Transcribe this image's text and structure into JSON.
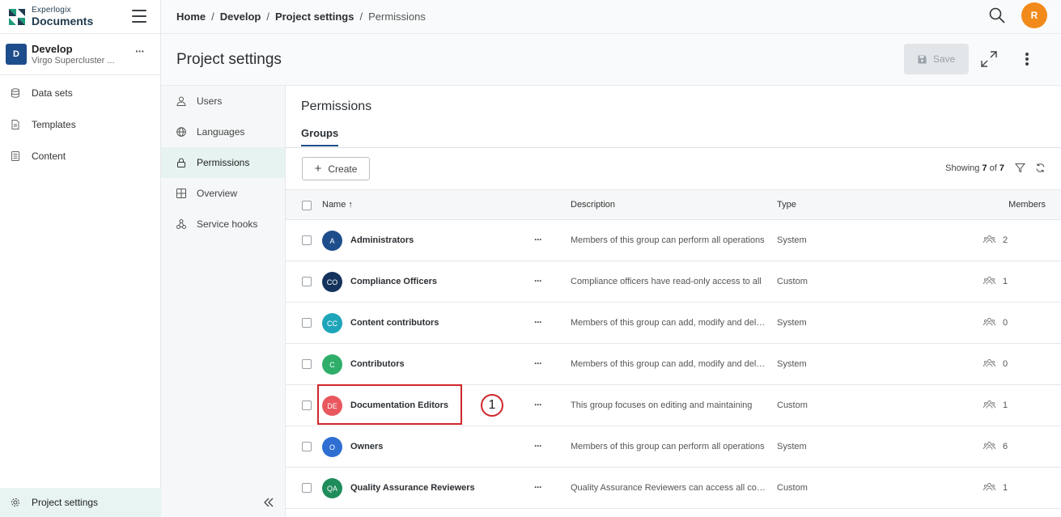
{
  "brand": {
    "top": "Experlogix",
    "main": "Documents"
  },
  "project": {
    "initial": "D",
    "name": "Develop",
    "subtitle": "Virgo Supercluster ...",
    "more": "···"
  },
  "sidebar": {
    "items": [
      {
        "label": "Data sets",
        "icon": "database-icon"
      },
      {
        "label": "Templates",
        "icon": "template-icon"
      },
      {
        "label": "Content",
        "icon": "content-icon"
      }
    ],
    "bottom": {
      "label": "Project settings",
      "icon": "gear-icon"
    }
  },
  "breadcrumb": {
    "items": [
      "Home",
      "Develop",
      "Project settings",
      "Permissions"
    ],
    "separator": "/"
  },
  "user": {
    "initial": "R",
    "color": "#f28a1b"
  },
  "header": {
    "title": "Project settings",
    "save_label": "Save"
  },
  "subnav": {
    "items": [
      {
        "label": "Users",
        "icon": "user-icon"
      },
      {
        "label": "Languages",
        "icon": "globe-icon"
      },
      {
        "label": "Permissions",
        "icon": "lock-icon",
        "active": true
      },
      {
        "label": "Overview",
        "icon": "grid-icon"
      },
      {
        "label": "Service hooks",
        "icon": "hooks-icon"
      }
    ]
  },
  "main": {
    "section_title": "Permissions",
    "tab": "Groups",
    "create_label": "Create",
    "showing": {
      "prefix": "Showing",
      "shown": "7",
      "of": "of",
      "total": "7"
    },
    "columns": {
      "name": "Name",
      "sort_arrow": "↑",
      "description": "Description",
      "type": "Type",
      "members": "Members"
    },
    "groups": [
      {
        "initials": "A",
        "color": "#1e4d8c",
        "name": "Administrators",
        "description": "Members of this group can perform all operations",
        "type": "System",
        "members": "2"
      },
      {
        "initials": "CO",
        "color": "#14335c",
        "name": "Compliance Officers",
        "description": "Compliance officers have read-only access to all",
        "type": "Custom",
        "members": "1"
      },
      {
        "initials": "CC",
        "color": "#1ea5b9",
        "name": "Content contributors",
        "description": "Members of this group can add, modify and delete",
        "type": "System",
        "members": "0"
      },
      {
        "initials": "C",
        "color": "#2fae6a",
        "name": "Contributors",
        "description": "Members of this group can add, modify and delete",
        "type": "System",
        "members": "0"
      },
      {
        "initials": "DE",
        "color": "#e9575e",
        "name": "Documentation Editors",
        "description": "This group focuses on editing and maintaining",
        "type": "Custom",
        "members": "1"
      },
      {
        "initials": "O",
        "color": "#2e6fd1",
        "name": "Owners",
        "description": "Members of this group can perform all operations",
        "type": "System",
        "members": "6"
      },
      {
        "initials": "QA",
        "color": "#1f8c5c",
        "name": "Quality Assurance Reviewers",
        "description": "Quality Assurance Reviewers can access all content",
        "type": "Custom",
        "members": "1"
      }
    ],
    "annotation": {
      "label": "1"
    }
  }
}
